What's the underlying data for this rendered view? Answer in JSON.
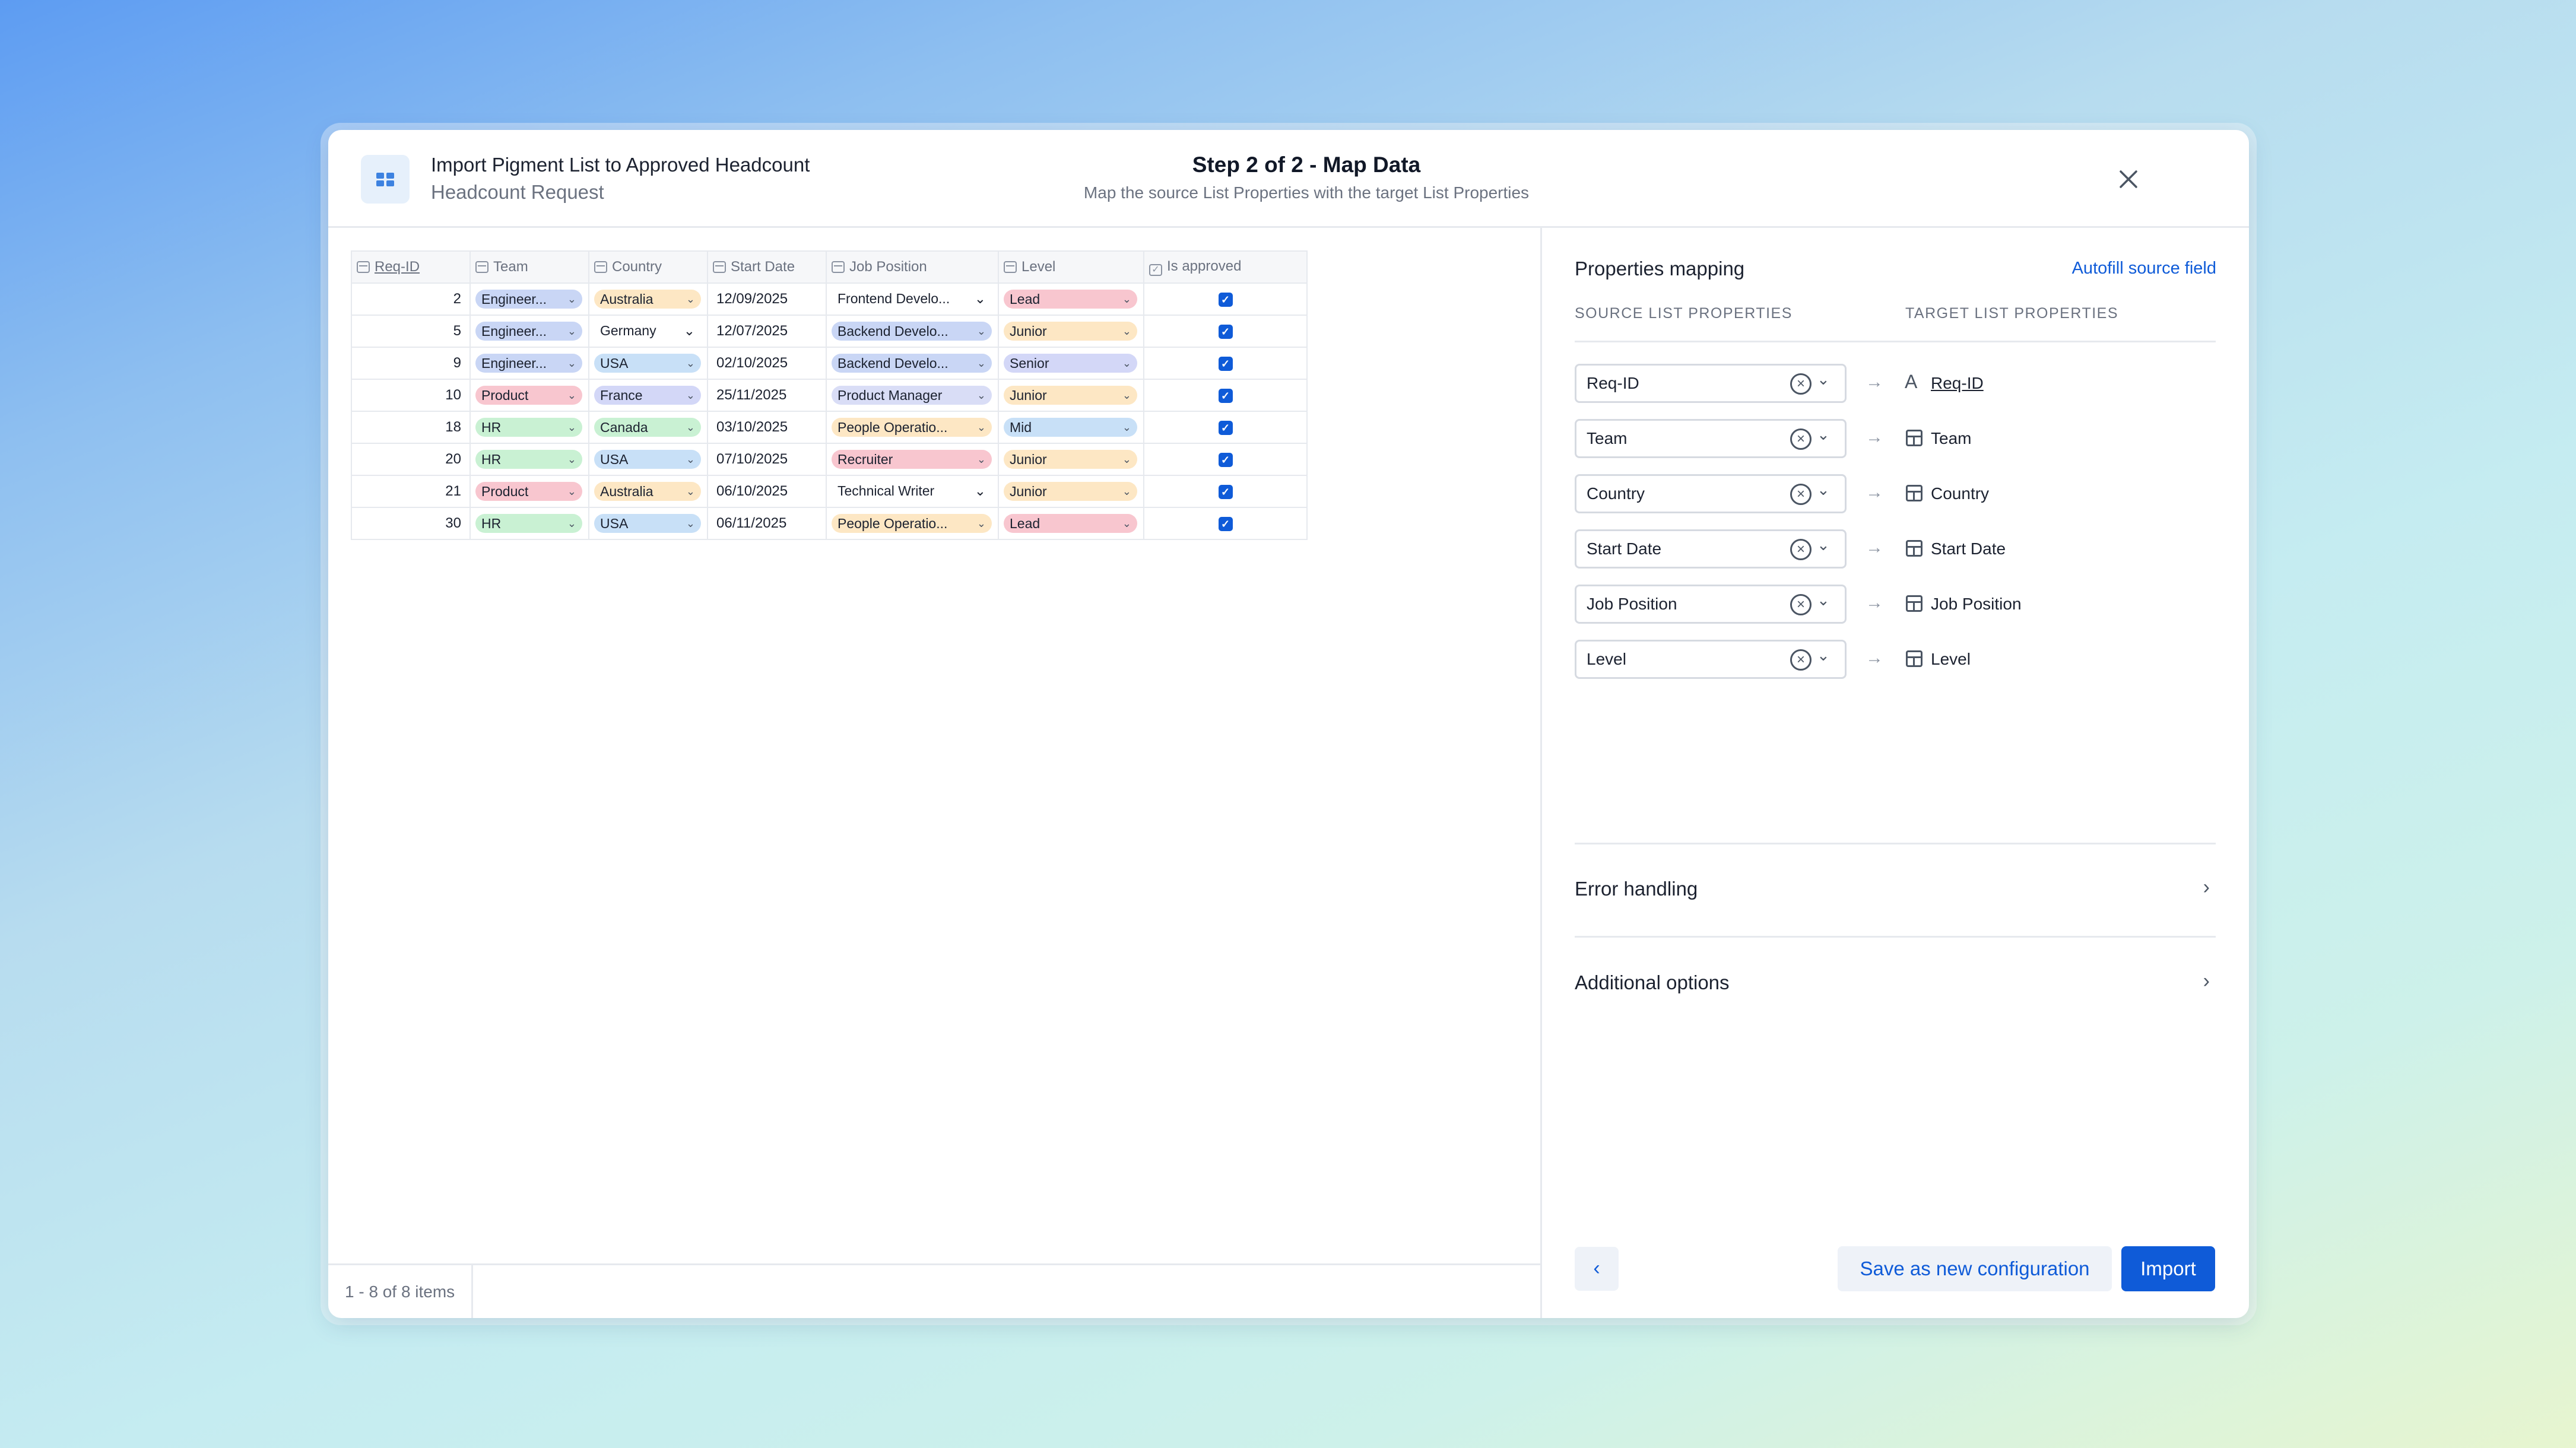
{
  "header": {
    "title": "Import Pigment List to Approved Headcount",
    "subtitle": "Headcount Request",
    "step_title": "Step 2 of 2 - Map Data",
    "step_subtitle": "Map the source List Properties with the target List Properties",
    "close_icon": "close-icon"
  },
  "table": {
    "columns": [
      "Req-ID",
      "Team",
      "Country",
      "Start Date",
      "Job Position",
      "Level",
      "Is approved"
    ],
    "rows": [
      {
        "id": "2",
        "team": "Engineer...",
        "country": "Australia",
        "date": "12/09/2025",
        "position": "Frontend Develo...",
        "level": "Lead",
        "approved": true
      },
      {
        "id": "5",
        "team": "Engineer...",
        "country": "Germany",
        "date": "12/07/2025",
        "position": "Backend Develo...",
        "level": "Junior",
        "approved": true
      },
      {
        "id": "9",
        "team": "Engineer...",
        "country": "USA",
        "date": "02/10/2025",
        "position": "Backend Develo...",
        "level": "Senior",
        "approved": true
      },
      {
        "id": "10",
        "team": "Product",
        "country": "France",
        "date": "25/11/2025",
        "position": "Product Manager",
        "level": "Junior",
        "approved": true
      },
      {
        "id": "18",
        "team": "HR",
        "country": "Canada",
        "date": "03/10/2025",
        "position": "People Operatio...",
        "level": "Mid",
        "approved": true
      },
      {
        "id": "20",
        "team": "HR",
        "country": "USA",
        "date": "07/10/2025",
        "position": "Recruiter",
        "level": "Junior",
        "approved": true
      },
      {
        "id": "21",
        "team": "Product",
        "country": "Australia",
        "date": "06/10/2025",
        "position": "Technical Writer",
        "level": "Junior",
        "approved": true
      },
      {
        "id": "30",
        "team": "HR",
        "country": "USA",
        "date": "06/11/2025",
        "position": "People Operatio...",
        "level": "Lead",
        "approved": true
      }
    ],
    "pagination": "1 - 8 of 8 items"
  },
  "mapping": {
    "title": "Properties mapping",
    "autofill": "Autofill source field",
    "source_header": "SOURCE LIST PROPERTIES",
    "target_header": "TARGET LIST PROPERTIES",
    "rows": [
      {
        "source": "Req-ID",
        "target": "Req-ID"
      },
      {
        "source": "Team",
        "target": "Team"
      },
      {
        "source": "Country",
        "target": "Country"
      },
      {
        "source": "Start Date",
        "target": "Start Date"
      },
      {
        "source": "Job Position",
        "target": "Job Position"
      },
      {
        "source": "Level",
        "target": "Level"
      }
    ],
    "arrow": "→",
    "error_handling": "Error handling",
    "additional_options": "Additional options"
  },
  "footer": {
    "back": "‹",
    "save": "Save as new configuration",
    "import": "Import"
  },
  "colors": {
    "accent": "#0f5bd8",
    "team": {
      "Engineer...": "#c9d6f5",
      "Product": "#f8c6cf",
      "HR": "#c9f1d3"
    },
    "country": {
      "Australia": "#fde7c4",
      "Germany": "none",
      "USA": "#c8e0f7",
      "France": "#d3d7f7",
      "Canada": "#c9f1d3"
    },
    "position": {
      "Frontend Develo...": "none",
      "Backend Develo...": "#c9d6f5",
      "Product Manager": "#d9ddf6",
      "People Operatio...": "#fde7c4",
      "Recruiter": "#f8c6cf",
      "Technical Writer": "none"
    },
    "level": {
      "Lead": "#f8c6cf",
      "Junior": "#fde7c4",
      "Senior": "#d3d7f7",
      "Mid": "#c8e0f7"
    }
  }
}
